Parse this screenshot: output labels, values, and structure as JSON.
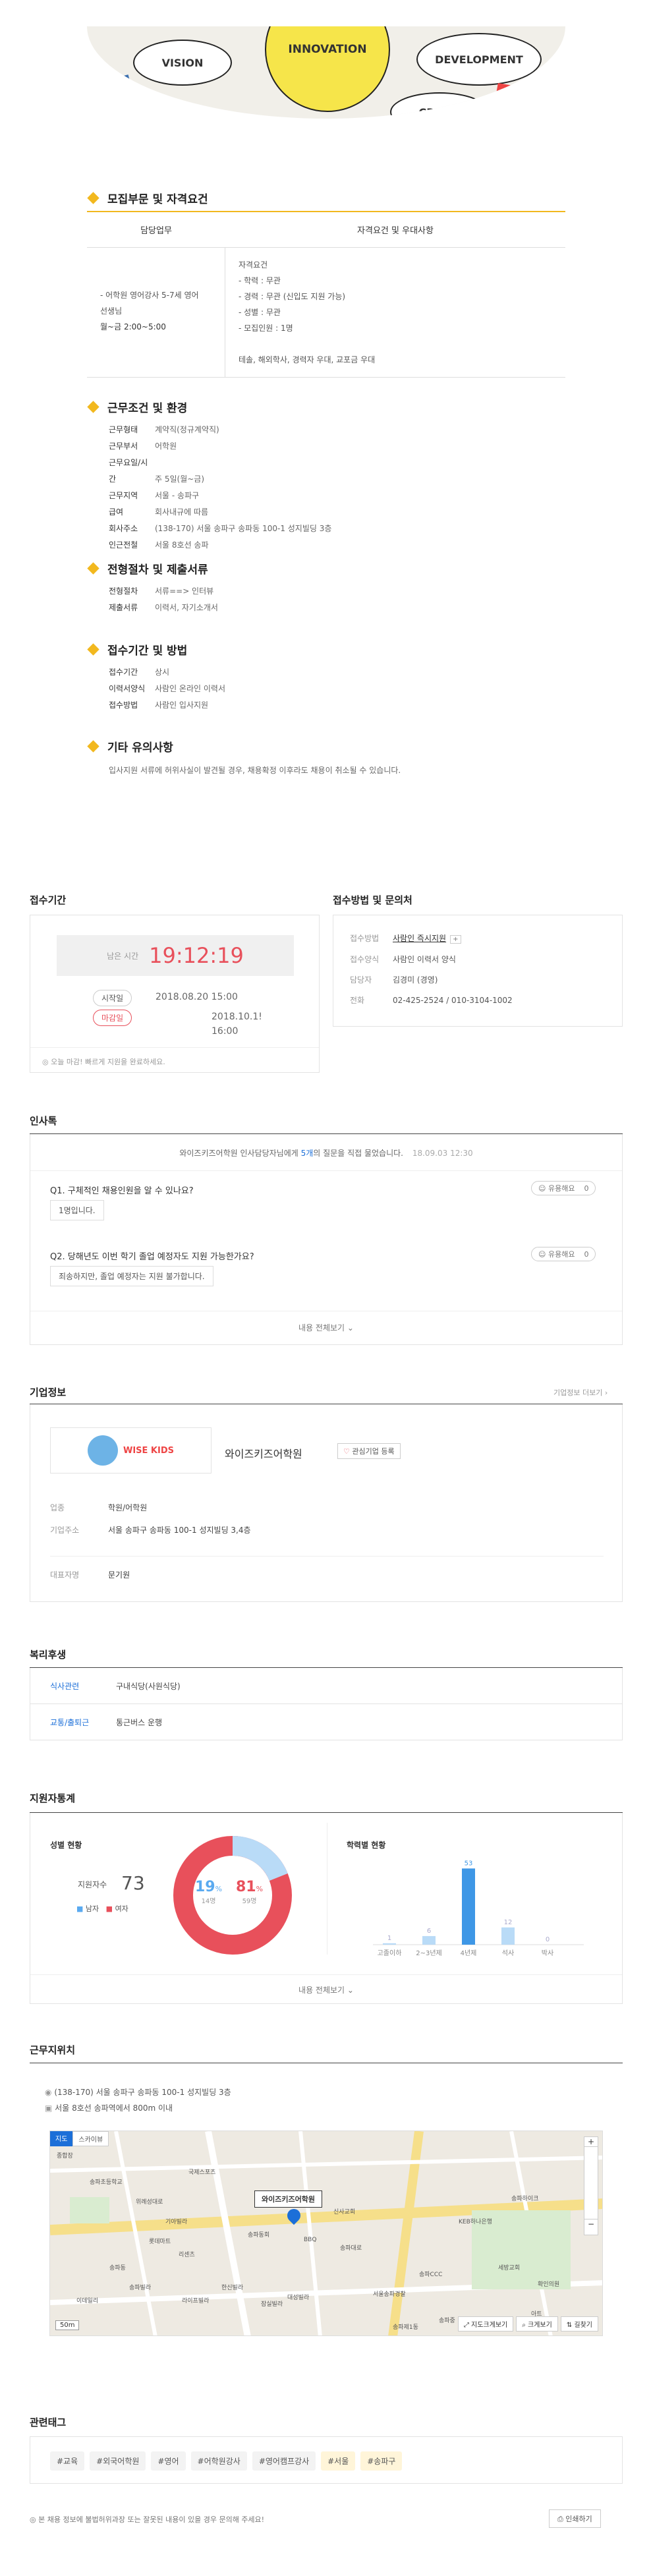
{
  "hero": {
    "words": [
      "VISION",
      "INNOVATION",
      "DEVELOPMENT",
      "CREATI"
    ]
  },
  "sections": {
    "req": {
      "title": "모집부문 및 자격요건",
      "col1": "담당업무",
      "col2": "자격요건 및 우대사항",
      "duty": [
        "- 어학원 영어강사 5-7세 영어",
        "선생님",
        "월~금 2:00~5:00"
      ],
      "qual": [
        "자격요건",
        "- 학력 : 무관",
        "- 경력 : 무관 (신입도 지원 가능)",
        "- 성별 : 무관",
        "- 모집인원 : 1명",
        "",
        "테솔, 해외학사, 경력자 우대, 교포금 우대"
      ]
    },
    "work": {
      "title": "근무조건 및 환경",
      "rows": [
        [
          "근무형태",
          "계약직(정규계약직)"
        ],
        [
          "근무부서",
          "어학원"
        ],
        [
          "근무요일/시간",
          "주 5일(월~금)"
        ],
        [
          "근무지역",
          "서울 - 송파구"
        ],
        [
          "급여",
          "회사내규에 따름"
        ],
        [
          "회사주소",
          "(138-170) 서울 송파구 송파동 100-1 성지빌딩 3층"
        ],
        [
          "인근전철",
          "서울 8호선 송파"
        ]
      ]
    },
    "process": {
      "title": "전형절차 및 제출서류",
      "rows": [
        [
          "전형절차",
          "서류==> 인터뷰"
        ],
        [
          "제출서류",
          "이력서, 자기소개서"
        ]
      ]
    },
    "apply": {
      "title": "접수기간 및 방법",
      "rows": [
        [
          "접수기간",
          "상시"
        ],
        [
          "이력서양식",
          "사람인 온라인 이력서"
        ],
        [
          "접수방법",
          "사람인 입사지원"
        ]
      ]
    },
    "etc": {
      "title": "기타 유의사항",
      "text": "입사지원 서류에 허위사실이 발견될 경우, 채용확정 이후라도 채용이 취소될 수 있습니다."
    }
  },
  "period": {
    "title": "접수기간",
    "remain_label": "남은 시간",
    "remain": "19:12:19",
    "start_label": "시작일",
    "start": "2018.08.20 15:00",
    "end_label": "마감일",
    "end1": "2018.10.1!",
    "end2": "16:00",
    "note": "오늘 마감! 빠르게 지원을 완료하세요."
  },
  "contact": {
    "title": "접수방법 및 문의처",
    "rows": [
      [
        "접수방법",
        "사람인 즉시지원",
        "+"
      ],
      [
        "접수양식",
        "사람인 이력서 양식",
        ""
      ],
      [
        "담당자",
        "김경미 (경영)",
        ""
      ],
      [
        "전화",
        "02-425-2524 / 010-3104-1002",
        ""
      ]
    ]
  },
  "talk": {
    "title": "인사톡",
    "header_a": "와이즈키즈어학원",
    "header_b": " 인사담당자님에게 ",
    "header_n": "5개",
    "header_c": "의 질문을 직접 물었습니다.",
    "header_date": "18.09.03 12:30",
    "qa": [
      {
        "q": "Q1. 구체적인 채용인원을 알 수 있나요?",
        "a": "1명입니다.",
        "useful": "유용해요",
        "count": "0"
      },
      {
        "q": "Q2. 당해년도 이번 학기 졸업 예정자도 지원 가능한가요?",
        "a": "죄송하지만, 졸업 예정자는 지원 불가합니다.",
        "useful": "유용해요",
        "count": "0"
      }
    ],
    "more": "내용 전체보기"
  },
  "company": {
    "title": "기업정보",
    "more": "기업정보 더보기",
    "name": "와이즈키즈어학원",
    "fav": "관심기업 등록",
    "logo": "WISE KIDS",
    "rows": [
      [
        "업종",
        "학원/어학원"
      ],
      [
        "기업주소",
        "서울 송파구 송파동 100-1 성지빌딩 3,4층"
      ]
    ],
    "ceo_k": "대표자명",
    "ceo_v": "문기원"
  },
  "welfare": {
    "title": "복리후생",
    "rows": [
      [
        "식사관련",
        "구내식당(사원식당)"
      ],
      [
        "교통/출퇴근",
        "통근버스 운행"
      ]
    ]
  },
  "stats": {
    "title": "지원자통계",
    "gender_title": "성별 현황",
    "applicants_label": "지원자수",
    "applicants": "73",
    "male": "남자",
    "female": "여자",
    "male_pct": "19",
    "male_n": "14명",
    "female_pct": "81",
    "female_n": "59명",
    "edu_title": "학력별 현황",
    "more": "내용 전체보기"
  },
  "chart_data": {
    "type": "bar",
    "categories": [
      "고졸이하",
      "2~3년제",
      "4년제",
      "석사",
      "박사"
    ],
    "values": [
      1,
      6,
      53,
      12,
      0
    ],
    "ylim": [
      0,
      55
    ]
  },
  "location": {
    "title": "근무지위치",
    "addr": "(138-170) 서울 송파구 송파동 100-1 성지빌딩 3층",
    "subway": "서울 8호선 송파역에서 800m 이내",
    "map_tab1": "지도",
    "map_tab2": "스카이뷰",
    "marker": "와이즈키즈어학원",
    "btn1": "지도크게보기",
    "btn2": "크게보기",
    "btn3": "길찾기",
    "scale": "50m",
    "places": [
      "종합장",
      "송파초등학교",
      "위례성대로",
      "국제스포츠",
      "기아빌라",
      "롯데마트",
      "리센츠",
      "송파동",
      "송파빌라",
      "이데일리",
      "라이프빌라",
      "한신빌라",
      "잠실빌라",
      "대성빌라",
      "송파동회",
      "송파대로",
      "BBQ",
      "신사교회",
      "KEB하나은행",
      "세방교회",
      "송파하이크",
      "확인의원",
      "아트",
      "송파CCC",
      "서울송파경찰",
      "송파제1동",
      "송파중"
    ]
  },
  "tags": {
    "title": "관련태그",
    "items": [
      "#교육",
      "#외국어학원",
      "#영어",
      "#어학원강사",
      "#영어캠프강사",
      "#서울",
      "#송파구"
    ]
  },
  "footer": {
    "note": "본 채용 정보에 불법허위과장 또는 잘못된 내용이 있을 경우 문의해 주세요!",
    "print": "인쇄하기"
  },
  "colors": {
    "accent": "#f2b81e",
    "red": "#e8505b",
    "blue": "#5aaaf0",
    "map_blue": "#1c6fd8"
  }
}
